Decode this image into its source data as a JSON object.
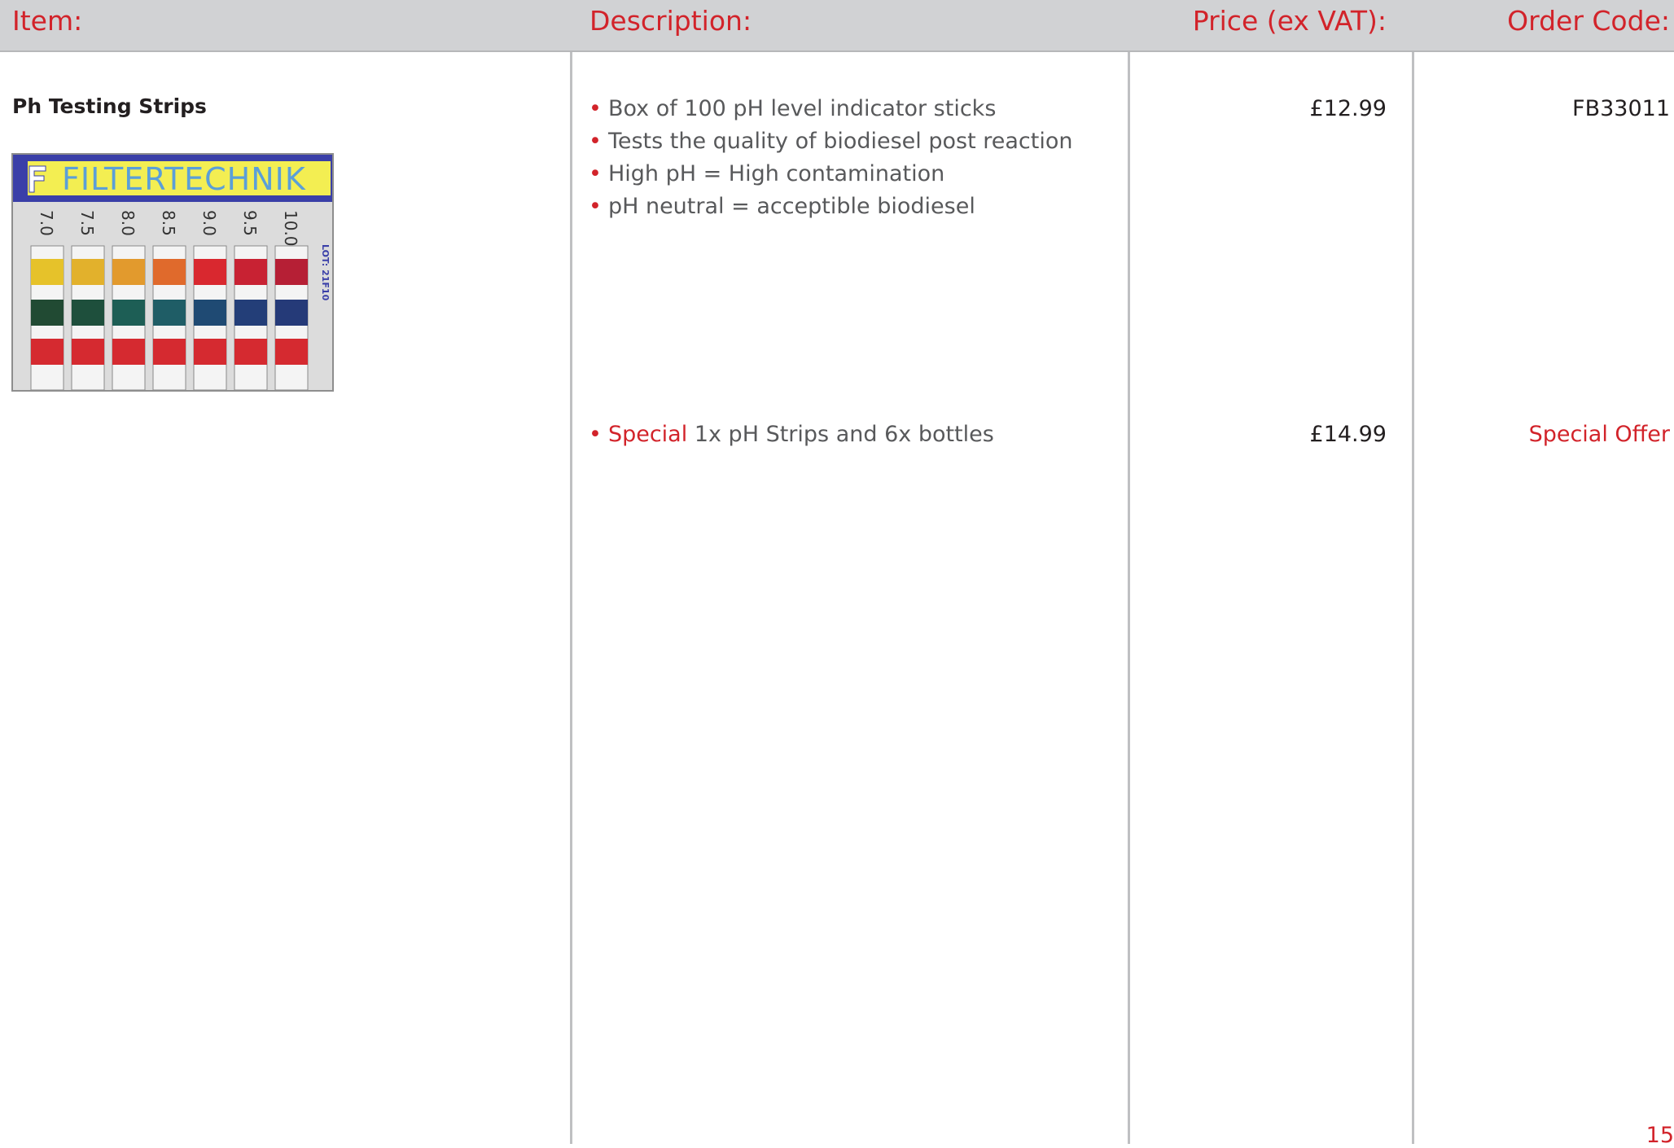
{
  "header": {
    "item": "Item:",
    "description": "Description:",
    "price": "Price (ex VAT):",
    "order_code": "Order Code:"
  },
  "product": {
    "name": "Ph Testing Strips",
    "image": {
      "brand": "FILTERTECHNIK",
      "lot": "LOT: 21F10",
      "scale": [
        "7.0",
        "7.5",
        "8.0",
        "8.5",
        "9.0",
        "9.5",
        "10.0"
      ]
    },
    "rows": [
      {
        "description": [
          "Box of  100 pH level indicator sticks",
          "Tests the quality of  biodiesel post reaction",
          "High pH = High contamination",
          "pH neutral = acceptible biodiesel"
        ],
        "price": "£12.99",
        "order_code": "FB33011"
      },
      {
        "special_label": "Special",
        "special_text": " 1x pH Strips and 6x bottles",
        "price": "£14.99",
        "order_code": "Special Offer"
      }
    ]
  },
  "page": {
    "number": "15"
  },
  "colors": {
    "accent": "#d2232a",
    "header_bg": "#d1d2d4",
    "text": "#58595b"
  }
}
